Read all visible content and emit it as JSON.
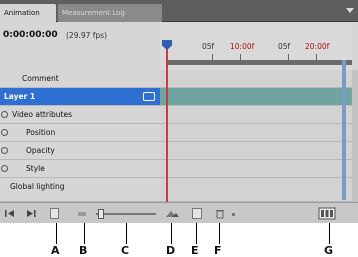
{
  "tabs": [
    {
      "label": "Animation"
    },
    {
      "label": "Measurement Log"
    }
  ],
  "header": {
    "timecode": "0:00:00:00",
    "framerate": "(29.97 fps)"
  },
  "ruler": {
    "labels": [
      "05f",
      "10:00f",
      "05f",
      "20:00f"
    ]
  },
  "layers": [
    {
      "label": "Comment"
    },
    {
      "label": "Layer 1",
      "selected": true
    },
    {
      "label": "Video attributes"
    },
    {
      "label": "Position"
    },
    {
      "label": "Opacity"
    },
    {
      "label": "Style"
    },
    {
      "label": "Global lighting"
    }
  ],
  "callouts": [
    "A",
    "B",
    "C",
    "D",
    "E",
    "F",
    "G"
  ],
  "colors": {
    "selection": "#2f6fd4",
    "track_selected": "#6ea5a0",
    "time_indicator": "#c04040"
  }
}
